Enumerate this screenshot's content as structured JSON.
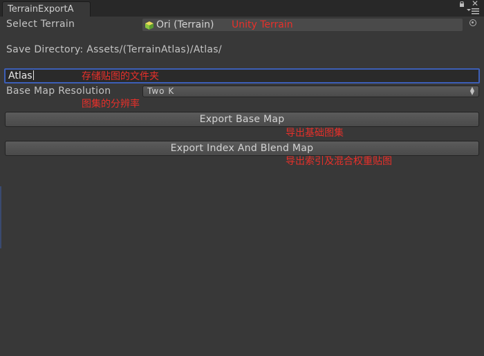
{
  "window": {
    "tab_title": "TerrainExportA",
    "icons": [
      "lock-icon",
      "close-icon",
      "menu-icon"
    ]
  },
  "terrain": {
    "label": "Select Terrain",
    "object_name": "Ori (Terrain)",
    "annotation": "Unity Terrain",
    "object_icon": "terrain-cube-icon",
    "picker_icon": "object-picker-icon"
  },
  "save": {
    "label": "Save Directory: Assets/(TerrainAtlas)/Atlas/"
  },
  "folder_input": {
    "value": "Atlas",
    "annotation": "存储贴图的文件夹"
  },
  "resolution": {
    "label": "Base Map Resolution",
    "selected": "Two K",
    "annotation": "图集的分辨率"
  },
  "buttons": {
    "export_base": "Export Base Map",
    "export_base_annotation": "导出基础图集",
    "export_index": "Export Index And Blend Map",
    "export_index_annotation": "导出索引及混合权重贴图"
  },
  "colors": {
    "background": "#383838",
    "annotation_red": "#e8302a",
    "focus_blue": "#3d5fb8"
  }
}
